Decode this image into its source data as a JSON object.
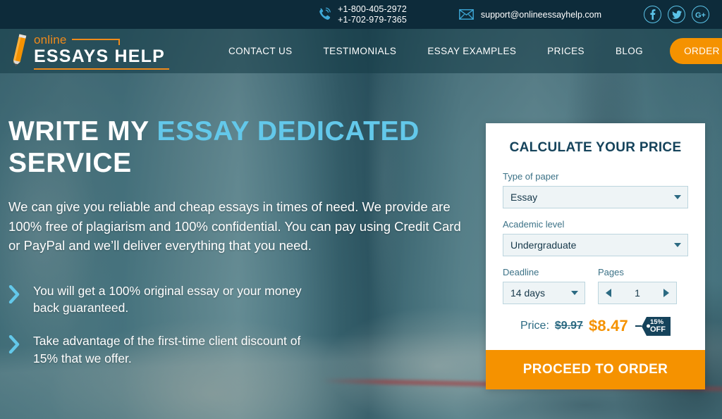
{
  "topbar": {
    "phone_icon": "phone-icon",
    "phones": [
      "+1-800-405-2972",
      "+1-702-979-7365"
    ],
    "mail_icon": "envelope-icon",
    "email": "support@onlineessayhelp.com",
    "socials": [
      {
        "name": "facebook-icon",
        "glyph": "f"
      },
      {
        "name": "twitter-icon",
        "glyph": "t"
      },
      {
        "name": "google-plus-icon",
        "glyph": "G+"
      }
    ],
    "bg_color": "#0d2b3a",
    "accent_color": "#5bc3e8"
  },
  "nav": {
    "logo": {
      "icon": "pencil-icon",
      "word_top": "online",
      "word_main": "ESSAYS HELP",
      "accent_color": "#f08a1a"
    },
    "links": [
      {
        "label": "CONTACT US"
      },
      {
        "label": "TESTIMONIALS"
      },
      {
        "label": "ESSAY EXAMPLES"
      },
      {
        "label": "PRICES"
      },
      {
        "label": "BLOG"
      }
    ],
    "cta_label": "ORDER NOW",
    "cta_color": "#f59200"
  },
  "hero": {
    "title_plain": "WRITE MY ",
    "title_accent": "ESSAY DEDICATED",
    "title_rest": "SERVICE",
    "accent_color": "#63c8ea",
    "paragraph": "We can give you reliable and cheap essays in times of need. We provide are 100% free of plagiarism and 100% confidential. You can pay using Credit Card or PayPal and we’ll deliver everything that you need.",
    "bullets": [
      {
        "icon": "chevron-right-icon",
        "text": "You will get a 100% original essay or your money back guaranteed."
      },
      {
        "icon": "chevron-right-icon",
        "text": "Take advantage of the first-time client discount of 15% that we offer."
      }
    ]
  },
  "calculator": {
    "title": "CALCULATE YOUR PRICE",
    "fields": [
      {
        "label": "Type of paper",
        "value": "Essay",
        "icon": "chevron-down-icon"
      },
      {
        "label": "Academic level",
        "value": "Undergraduate",
        "icon": "chevron-down-icon"
      }
    ],
    "deadline": {
      "label": "Deadline",
      "value": "14 days",
      "icon": "chevron-down-icon"
    },
    "pages": {
      "label": "Pages",
      "value": "1",
      "dec_icon": "triangle-left-icon",
      "inc_icon": "triangle-right-icon"
    },
    "price": {
      "label": "Price:",
      "old": "$9.97",
      "new": "$8.47",
      "badge_line1": "15%",
      "badge_line2": "OFF",
      "new_color": "#f59200",
      "badge_color": "#15435b"
    },
    "cta_label": "PROCEED TO ORDER",
    "cta_color": "#f59200"
  }
}
